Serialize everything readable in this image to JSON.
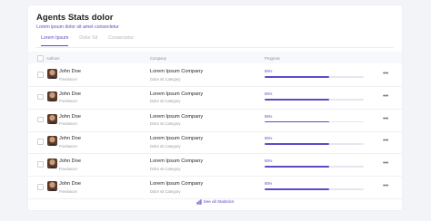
{
  "header": {
    "title": "Agents Stats dolor",
    "subtitle": "Lorem ipsum dolor sit amet consectetur"
  },
  "tabs": [
    "Lorem Ipsum",
    "Dolor Sit",
    "Consectetur"
  ],
  "table": {
    "columns": [
      "Authors",
      "Company",
      "Progress"
    ],
    "rows": [
      {
        "name": "John Doe",
        "role": "Freelancer",
        "company": "Lorem Ipsum Company",
        "category": "Dolor sit Category",
        "progress_label": "65%",
        "progress": 0.65
      },
      {
        "name": "John Doe",
        "role": "Freelancer",
        "company": "Lorem Ipsum Company",
        "category": "Dolor sit Category",
        "progress_label": "65%",
        "progress": 0.65
      },
      {
        "name": "John Doe",
        "role": "Freelancer",
        "company": "Lorem Ipsum Company",
        "category": "Dolor sit Category",
        "progress_label": "65%",
        "progress": 0.65
      },
      {
        "name": "John Doe",
        "role": "Freelancer",
        "company": "Lorem Ipsum Company",
        "category": "Dolor sit Category",
        "progress_label": "65%",
        "progress": 0.65
      },
      {
        "name": "John Doe",
        "role": "Freelancer",
        "company": "Lorem Ipsum Company",
        "category": "Dolor sit Category",
        "progress_label": "65%",
        "progress": 0.65
      },
      {
        "name": "John Doe",
        "role": "Freelancer",
        "company": "Lorem Ipsum Company",
        "category": "Dolor sit Category",
        "progress_label": "65%",
        "progress": 0.65
      }
    ]
  },
  "footer": {
    "link_label": "See all Statistics",
    "icon": "bar-chart-icon"
  },
  "colors": {
    "accent": "#5b4cc4",
    "background": "#f3f4f8"
  }
}
